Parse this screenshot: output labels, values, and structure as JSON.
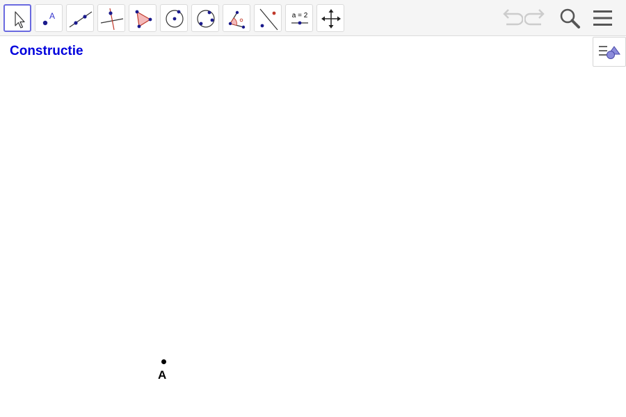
{
  "colors": {
    "title": "#0000dd",
    "point": "#000000",
    "active_tool_border": "#6a6ae0",
    "toolbar_bg": "#f5f5f5"
  },
  "toolbar": {
    "tools": [
      {
        "icon": "move-arrow-icon",
        "active": true
      },
      {
        "icon": "point-icon",
        "glyph": "A"
      },
      {
        "icon": "line-icon"
      },
      {
        "icon": "perpendicular-line-icon"
      },
      {
        "icon": "polygon-icon"
      },
      {
        "icon": "circle-center-point-icon"
      },
      {
        "icon": "circle-three-points-icon"
      },
      {
        "icon": "angle-icon"
      },
      {
        "icon": "reflect-icon"
      },
      {
        "icon": "slider-icon",
        "glyph": "a = 2"
      },
      {
        "icon": "move-view-icon"
      }
    ],
    "right_buttons": [
      "undo-icon",
      "redo-icon",
      "search-icon",
      "menu-icon"
    ]
  },
  "graphics": {
    "title": "Constructie",
    "point": {
      "label": "A"
    }
  }
}
